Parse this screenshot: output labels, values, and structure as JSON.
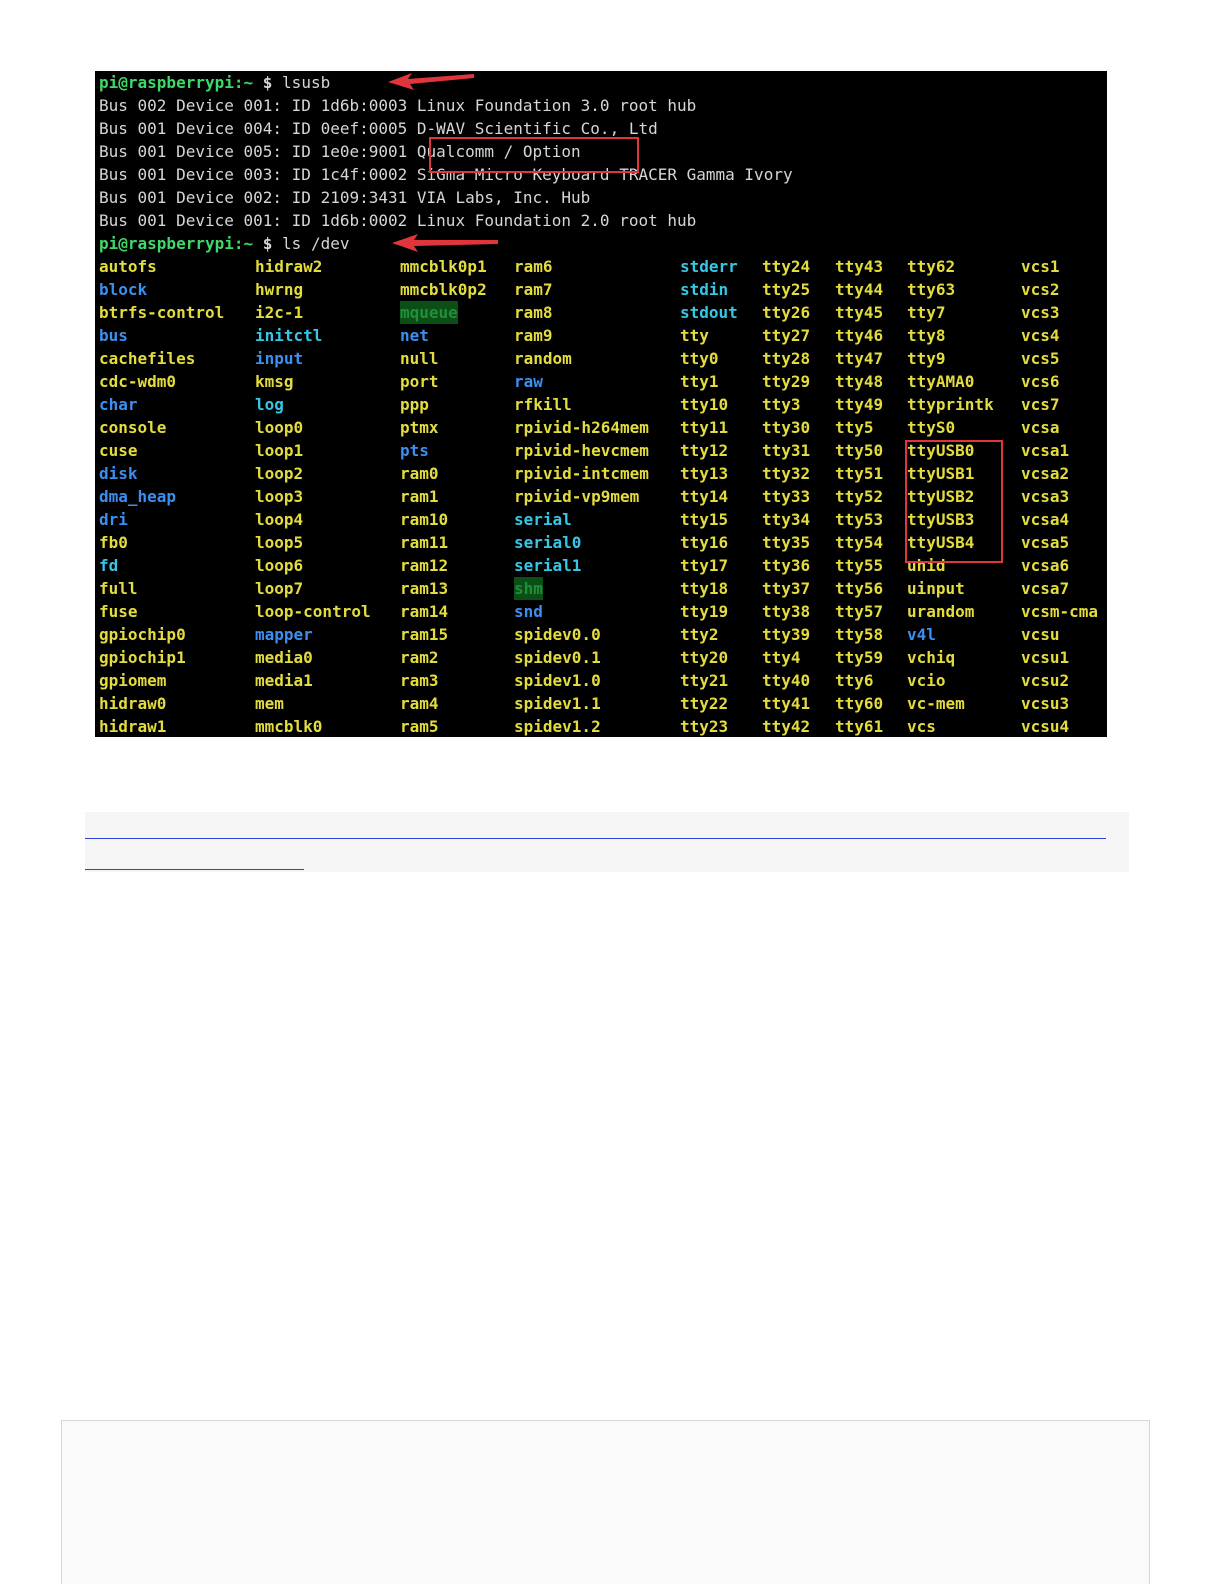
{
  "terminal": {
    "prompt_user": "pi@raspberrypi",
    "prompt_path": ":~",
    "prompt_symbol": "$",
    "commands": [
      "lsusb",
      "ls /dev"
    ],
    "lsusb_lines": [
      {
        "bus": "Bus 002 Device 001:",
        "id": "ID 1d6b:0003",
        "desc": "Linux Foundation 3.0 root hub"
      },
      {
        "bus": "Bus 001 Device 004:",
        "id": "ID 0eef:0005",
        "desc": "D-WAV Scientific Co., Ltd"
      },
      {
        "bus": "Bus 001 Device 005:",
        "id": "ID 1e0e:9001",
        "desc": "Qualcomm / Option"
      },
      {
        "bus": "Bus 001 Device 003:",
        "id": "ID 1c4f:0002",
        "desc": "SiGma Micro Keyboard TRACER Gamma Ivory"
      },
      {
        "bus": "Bus 001 Device 002:",
        "id": "ID 2109:3431",
        "desc": "VIA Labs, Inc. Hub"
      },
      {
        "bus": "Bus 001 Device 001:",
        "id": "ID 1d6b:0002",
        "desc": "Linux Foundation 2.0 root hub"
      }
    ],
    "ls_columns": [
      [
        {
          "name": "autofs",
          "type": "dev"
        },
        {
          "name": "block",
          "type": "dir"
        },
        {
          "name": "btrfs-control",
          "type": "dev"
        },
        {
          "name": "bus",
          "type": "dir"
        },
        {
          "name": "cachefiles",
          "type": "dev"
        },
        {
          "name": "cdc-wdm0",
          "type": "dev"
        },
        {
          "name": "char",
          "type": "dir"
        },
        {
          "name": "console",
          "type": "dev"
        },
        {
          "name": "cuse",
          "type": "dev"
        },
        {
          "name": "disk",
          "type": "dir"
        },
        {
          "name": "dma_heap",
          "type": "dir"
        },
        {
          "name": "dri",
          "type": "dir"
        },
        {
          "name": "fb0",
          "type": "dev"
        },
        {
          "name": "fd",
          "type": "link"
        },
        {
          "name": "full",
          "type": "dev"
        },
        {
          "name": "fuse",
          "type": "dev"
        },
        {
          "name": "gpiochip0",
          "type": "dev"
        },
        {
          "name": "gpiochip1",
          "type": "dev"
        },
        {
          "name": "gpiomem",
          "type": "dev"
        },
        {
          "name": "hidraw0",
          "type": "dev"
        },
        {
          "name": "hidraw1",
          "type": "dev"
        }
      ],
      [
        {
          "name": "hidraw2",
          "type": "dev"
        },
        {
          "name": "hwrng",
          "type": "dev"
        },
        {
          "name": "i2c-1",
          "type": "dev"
        },
        {
          "name": "initctl",
          "type": "link"
        },
        {
          "name": "input",
          "type": "dir"
        },
        {
          "name": "kmsg",
          "type": "dev"
        },
        {
          "name": "log",
          "type": "link"
        },
        {
          "name": "loop0",
          "type": "dev"
        },
        {
          "name": "loop1",
          "type": "dev"
        },
        {
          "name": "loop2",
          "type": "dev"
        },
        {
          "name": "loop3",
          "type": "dev"
        },
        {
          "name": "loop4",
          "type": "dev"
        },
        {
          "name": "loop5",
          "type": "dev"
        },
        {
          "name": "loop6",
          "type": "dev"
        },
        {
          "name": "loop7",
          "type": "dev"
        },
        {
          "name": "loop-control",
          "type": "dev"
        },
        {
          "name": "mapper",
          "type": "dir"
        },
        {
          "name": "media0",
          "type": "dev"
        },
        {
          "name": "media1",
          "type": "dev"
        },
        {
          "name": "mem",
          "type": "dev"
        },
        {
          "name": "mmcblk0",
          "type": "dev"
        }
      ],
      [
        {
          "name": "mmcblk0p1",
          "type": "dev"
        },
        {
          "name": "mmcblk0p2",
          "type": "dev"
        },
        {
          "name": "mqueue",
          "type": "sticky"
        },
        {
          "name": "net",
          "type": "dir"
        },
        {
          "name": "null",
          "type": "dev"
        },
        {
          "name": "port",
          "type": "dev"
        },
        {
          "name": "ppp",
          "type": "dev"
        },
        {
          "name": "ptmx",
          "type": "dev"
        },
        {
          "name": "pts",
          "type": "dir"
        },
        {
          "name": "ram0",
          "type": "dev"
        },
        {
          "name": "ram1",
          "type": "dev"
        },
        {
          "name": "ram10",
          "type": "dev"
        },
        {
          "name": "ram11",
          "type": "dev"
        },
        {
          "name": "ram12",
          "type": "dev"
        },
        {
          "name": "ram13",
          "type": "dev"
        },
        {
          "name": "ram14",
          "type": "dev"
        },
        {
          "name": "ram15",
          "type": "dev"
        },
        {
          "name": "ram2",
          "type": "dev"
        },
        {
          "name": "ram3",
          "type": "dev"
        },
        {
          "name": "ram4",
          "type": "dev"
        },
        {
          "name": "ram5",
          "type": "dev"
        }
      ],
      [
        {
          "name": "ram6",
          "type": "dev"
        },
        {
          "name": "ram7",
          "type": "dev"
        },
        {
          "name": "ram8",
          "type": "dev"
        },
        {
          "name": "ram9",
          "type": "dev"
        },
        {
          "name": "random",
          "type": "dev"
        },
        {
          "name": "raw",
          "type": "dir"
        },
        {
          "name": "rfkill",
          "type": "dev"
        },
        {
          "name": "rpivid-h264mem",
          "type": "dev"
        },
        {
          "name": "rpivid-hevcmem",
          "type": "dev"
        },
        {
          "name": "rpivid-intcmem",
          "type": "dev"
        },
        {
          "name": "rpivid-vp9mem",
          "type": "dev"
        },
        {
          "name": "serial",
          "type": "link"
        },
        {
          "name": "serial0",
          "type": "link"
        },
        {
          "name": "serial1",
          "type": "link"
        },
        {
          "name": "shm",
          "type": "sticky"
        },
        {
          "name": "snd",
          "type": "dir"
        },
        {
          "name": "spidev0.0",
          "type": "dev"
        },
        {
          "name": "spidev0.1",
          "type": "dev"
        },
        {
          "name": "spidev1.0",
          "type": "dev"
        },
        {
          "name": "spidev1.1",
          "type": "dev"
        },
        {
          "name": "spidev1.2",
          "type": "dev"
        }
      ],
      [
        {
          "name": "stderr",
          "type": "link"
        },
        {
          "name": "stdin",
          "type": "link"
        },
        {
          "name": "stdout",
          "type": "link"
        },
        {
          "name": "tty",
          "type": "dev"
        },
        {
          "name": "tty0",
          "type": "dev"
        },
        {
          "name": "tty1",
          "type": "dev"
        },
        {
          "name": "tty10",
          "type": "dev"
        },
        {
          "name": "tty11",
          "type": "dev"
        },
        {
          "name": "tty12",
          "type": "dev"
        },
        {
          "name": "tty13",
          "type": "dev"
        },
        {
          "name": "tty14",
          "type": "dev"
        },
        {
          "name": "tty15",
          "type": "dev"
        },
        {
          "name": "tty16",
          "type": "dev"
        },
        {
          "name": "tty17",
          "type": "dev"
        },
        {
          "name": "tty18",
          "type": "dev"
        },
        {
          "name": "tty19",
          "type": "dev"
        },
        {
          "name": "tty2",
          "type": "dev"
        },
        {
          "name": "tty20",
          "type": "dev"
        },
        {
          "name": "tty21",
          "type": "dev"
        },
        {
          "name": "tty22",
          "type": "dev"
        },
        {
          "name": "tty23",
          "type": "dev"
        }
      ],
      [
        {
          "name": "tty24",
          "type": "dev"
        },
        {
          "name": "tty25",
          "type": "dev"
        },
        {
          "name": "tty26",
          "type": "dev"
        },
        {
          "name": "tty27",
          "type": "dev"
        },
        {
          "name": "tty28",
          "type": "dev"
        },
        {
          "name": "tty29",
          "type": "dev"
        },
        {
          "name": "tty3",
          "type": "dev"
        },
        {
          "name": "tty30",
          "type": "dev"
        },
        {
          "name": "tty31",
          "type": "dev"
        },
        {
          "name": "tty32",
          "type": "dev"
        },
        {
          "name": "tty33",
          "type": "dev"
        },
        {
          "name": "tty34",
          "type": "dev"
        },
        {
          "name": "tty35",
          "type": "dev"
        },
        {
          "name": "tty36",
          "type": "dev"
        },
        {
          "name": "tty37",
          "type": "dev"
        },
        {
          "name": "tty38",
          "type": "dev"
        },
        {
          "name": "tty39",
          "type": "dev"
        },
        {
          "name": "tty4",
          "type": "dev"
        },
        {
          "name": "tty40",
          "type": "dev"
        },
        {
          "name": "tty41",
          "type": "dev"
        },
        {
          "name": "tty42",
          "type": "dev"
        }
      ],
      [
        {
          "name": "tty43",
          "type": "dev"
        },
        {
          "name": "tty44",
          "type": "dev"
        },
        {
          "name": "tty45",
          "type": "dev"
        },
        {
          "name": "tty46",
          "type": "dev"
        },
        {
          "name": "tty47",
          "type": "dev"
        },
        {
          "name": "tty48",
          "type": "dev"
        },
        {
          "name": "tty49",
          "type": "dev"
        },
        {
          "name": "tty5",
          "type": "dev"
        },
        {
          "name": "tty50",
          "type": "dev"
        },
        {
          "name": "tty51",
          "type": "dev"
        },
        {
          "name": "tty52",
          "type": "dev"
        },
        {
          "name": "tty53",
          "type": "dev"
        },
        {
          "name": "tty54",
          "type": "dev"
        },
        {
          "name": "tty55",
          "type": "dev"
        },
        {
          "name": "tty56",
          "type": "dev"
        },
        {
          "name": "tty57",
          "type": "dev"
        },
        {
          "name": "tty58",
          "type": "dev"
        },
        {
          "name": "tty59",
          "type": "dev"
        },
        {
          "name": "tty6",
          "type": "dev"
        },
        {
          "name": "tty60",
          "type": "dev"
        },
        {
          "name": "tty61",
          "type": "dev"
        }
      ],
      [
        {
          "name": "tty62",
          "type": "dev"
        },
        {
          "name": "tty63",
          "type": "dev"
        },
        {
          "name": "tty7",
          "type": "dev"
        },
        {
          "name": "tty8",
          "type": "dev"
        },
        {
          "name": "tty9",
          "type": "dev"
        },
        {
          "name": "ttyAMA0",
          "type": "dev"
        },
        {
          "name": "ttyprintk",
          "type": "dev"
        },
        {
          "name": "ttyS0",
          "type": "dev"
        },
        {
          "name": "ttyUSB0",
          "type": "dev"
        },
        {
          "name": "ttyUSB1",
          "type": "dev"
        },
        {
          "name": "ttyUSB2",
          "type": "dev"
        },
        {
          "name": "ttyUSB3",
          "type": "dev"
        },
        {
          "name": "ttyUSB4",
          "type": "dev"
        },
        {
          "name": "uhid",
          "type": "dev"
        },
        {
          "name": "uinput",
          "type": "dev"
        },
        {
          "name": "urandom",
          "type": "dev"
        },
        {
          "name": "v4l",
          "type": "dir"
        },
        {
          "name": "vchiq",
          "type": "dev"
        },
        {
          "name": "vcio",
          "type": "dev"
        },
        {
          "name": "vc-mem",
          "type": "dev"
        },
        {
          "name": "vcs",
          "type": "dev"
        }
      ],
      [
        {
          "name": "vcs1",
          "type": "dev"
        },
        {
          "name": "vcs2",
          "type": "dev"
        },
        {
          "name": "vcs3",
          "type": "dev"
        },
        {
          "name": "vcs4",
          "type": "dev"
        },
        {
          "name": "vcs5",
          "type": "dev"
        },
        {
          "name": "vcs6",
          "type": "dev"
        },
        {
          "name": "vcs7",
          "type": "dev"
        },
        {
          "name": "vcsa",
          "type": "dev"
        },
        {
          "name": "vcsa1",
          "type": "dev"
        },
        {
          "name": "vcsa2",
          "type": "dev"
        },
        {
          "name": "vcsa3",
          "type": "dev"
        },
        {
          "name": "vcsa4",
          "type": "dev"
        },
        {
          "name": "vcsa5",
          "type": "dev"
        },
        {
          "name": "vcsa6",
          "type": "dev"
        },
        {
          "name": "vcsa7",
          "type": "dev"
        },
        {
          "name": "vcsm-cma",
          "type": "dev"
        },
        {
          "name": "vcsu",
          "type": "dev"
        },
        {
          "name": "vcsu1",
          "type": "dev"
        },
        {
          "name": "vcsu2",
          "type": "dev"
        },
        {
          "name": "vcsu3",
          "type": "dev"
        },
        {
          "name": "vcsu4",
          "type": "dev"
        }
      ]
    ]
  },
  "colors": {
    "terminal_bg": "#000000",
    "directory": "#3b8ff0",
    "device": "#e3dc3e",
    "symlink": "#36c6e6",
    "sticky_dir": "#1f8f3a",
    "prompt": "#3fd86a",
    "highlight": "#e0353b",
    "link": "#2a43d6"
  }
}
